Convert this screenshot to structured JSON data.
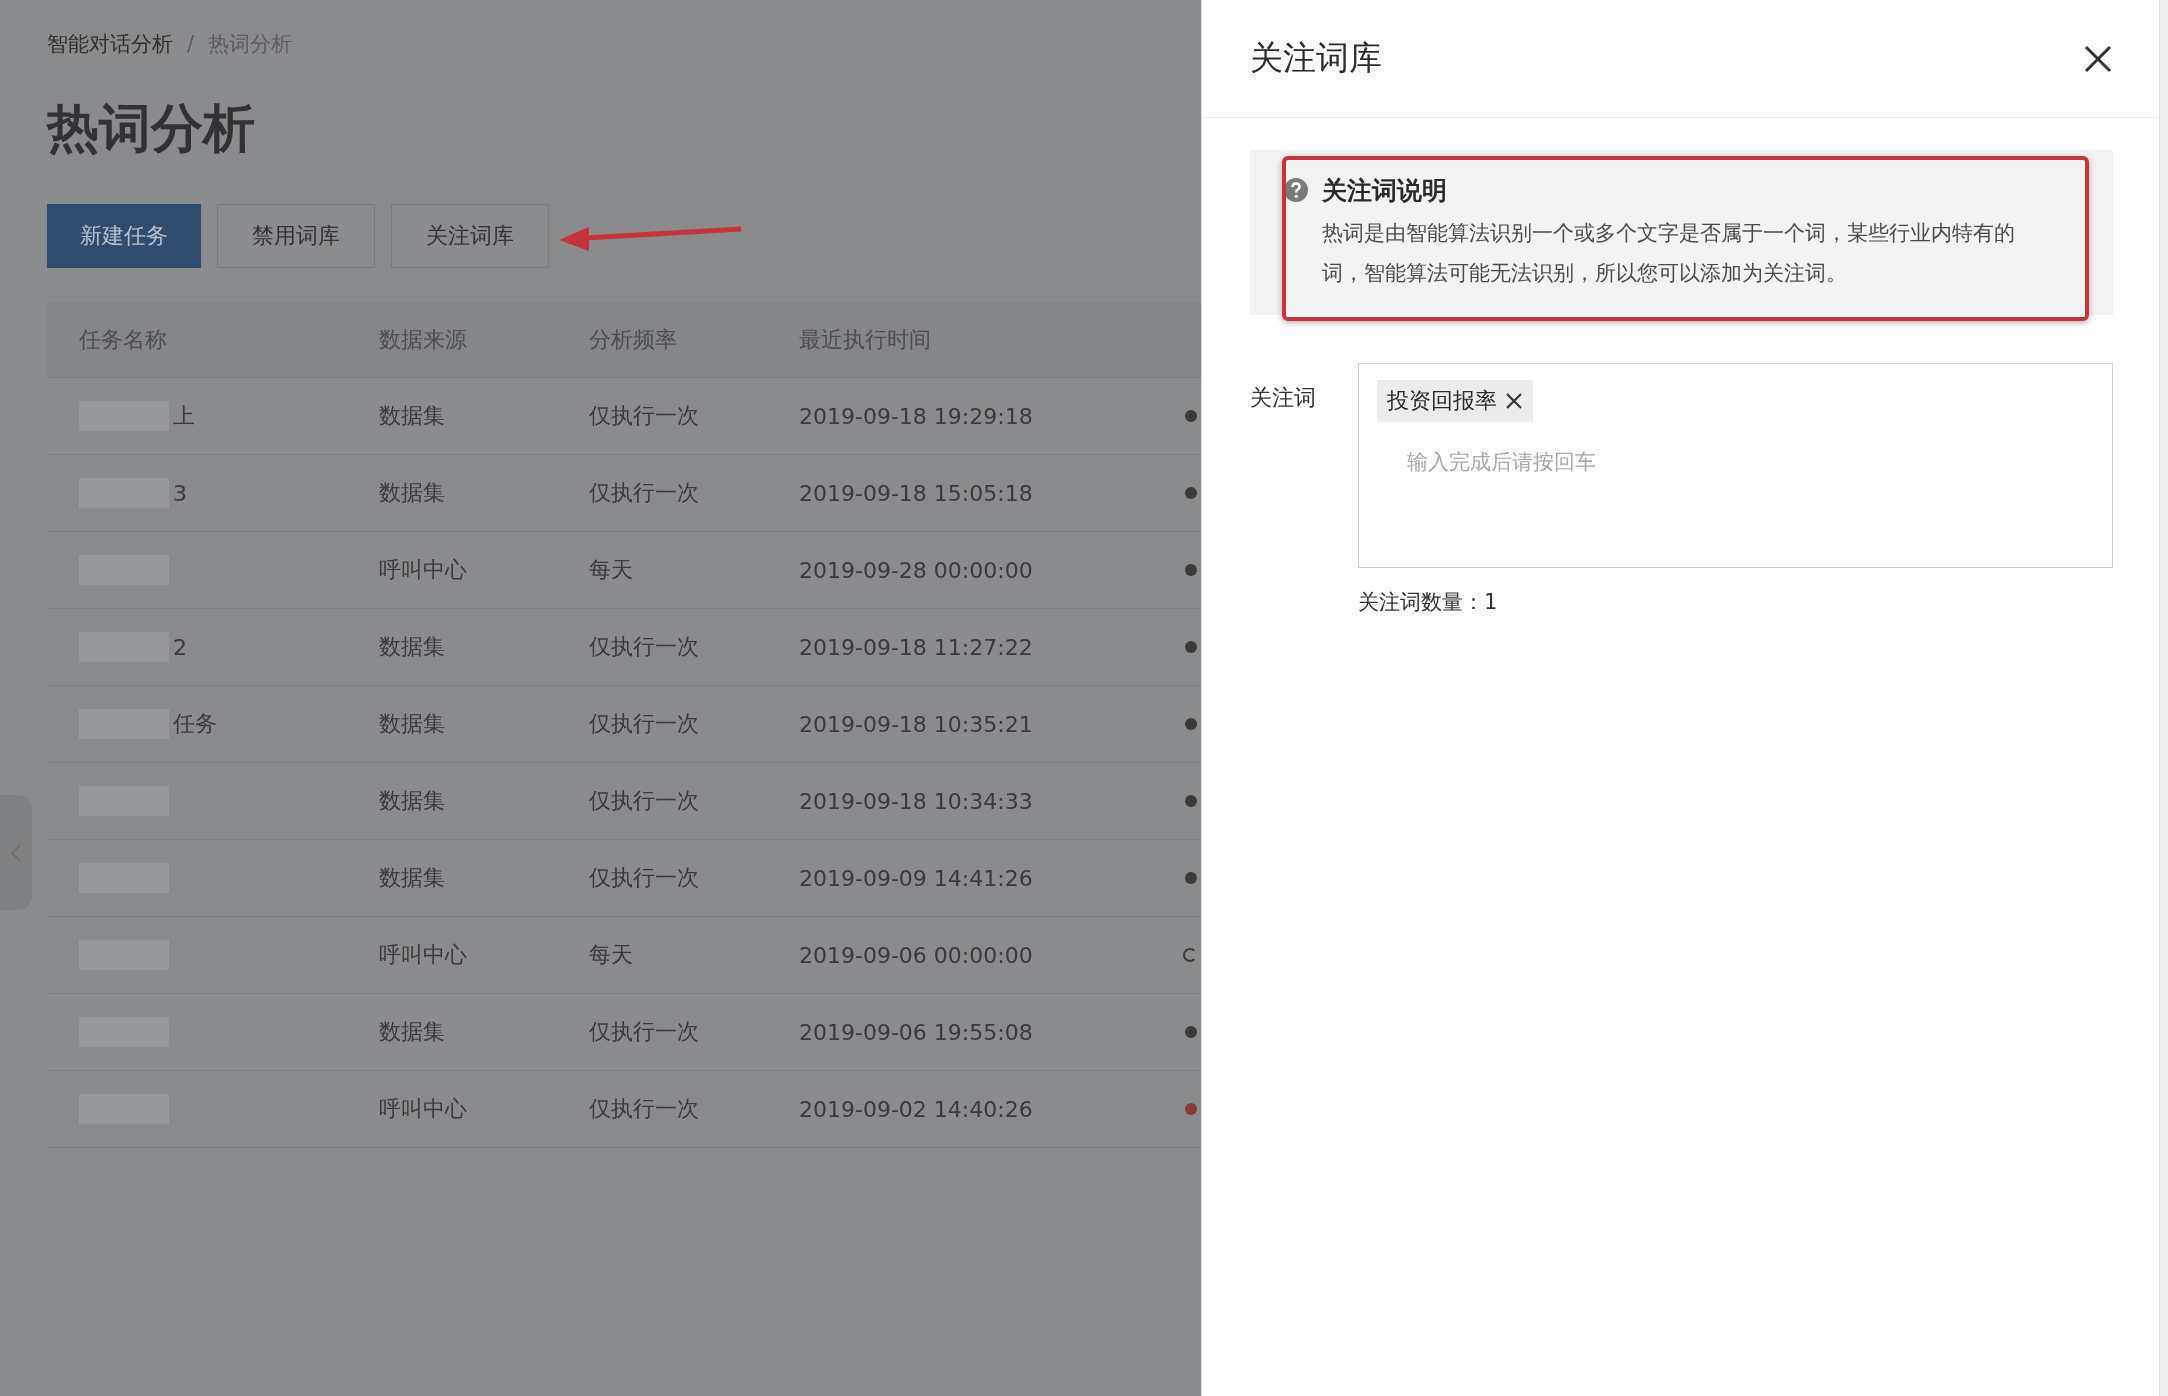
{
  "breadcrumb": [
    {
      "label": "智能对话分析",
      "current": false
    },
    {
      "label": "/",
      "kind": "separator"
    },
    {
      "label": "热词分析",
      "current": true
    }
  ],
  "page_title": "热词分析",
  "buttons": [
    {
      "label": "新建任务",
      "primary": true
    },
    {
      "label": "禁用词库",
      "primary": false
    },
    {
      "label": "关注词库",
      "primary": false,
      "annotated": true
    }
  ],
  "table": {
    "columns": [
      "任务名称",
      "数据来源",
      "分析频率",
      "最近执行时间"
    ],
    "rows": [
      {
        "name": "上",
        "redacted": true,
        "source": "数据集",
        "frequency": "仅执行一次",
        "time": "2019-09-18 19:29:18",
        "kind": "dot",
        "color": "#3a3a3a"
      },
      {
        "name": "3",
        "redacted": true,
        "source": "数据集",
        "frequency": "仅执行一次",
        "time": "2019-09-18 15:05:18",
        "kind": "dot",
        "color": "#3a3a3a"
      },
      {
        "redacted": true,
        "source": "呼叫中心",
        "frequency": "每天",
        "time": "2019-09-28 00:00:00",
        "kind": "dot",
        "color": "#3a3a3a"
      },
      {
        "name": "2",
        "redacted": true,
        "source": "数据集",
        "frequency": "仅执行一次",
        "time": "2019-09-18 11:27:22",
        "kind": "dot",
        "color": "#3a3a3a"
      },
      {
        "name": "任务",
        "redacted": true,
        "source": "数据集",
        "frequency": "仅执行一次",
        "time": "2019-09-18 10:35:21",
        "kind": "dot",
        "color": "#3a3a3a"
      },
      {
        "redacted": true,
        "source": "数据集",
        "frequency": "仅执行一次",
        "time": "2019-09-18 10:34:33",
        "kind": "dot",
        "color": "#3a3a3a"
      },
      {
        "redacted": true,
        "source": "数据集",
        "frequency": "仅执行一次",
        "time": "2019-09-09 14:41:26",
        "kind": "dot",
        "color": "#3a3a3a"
      },
      {
        "redacted": true,
        "source": "呼叫中心",
        "frequency": "每天",
        "time": "2019-09-06 00:00:00",
        "kind": "spinner",
        "color": "#3a3a3a"
      },
      {
        "redacted": true,
        "source": "数据集",
        "frequency": "仅执行一次",
        "time": "2019-09-06 19:55:08",
        "kind": "dot",
        "color": "#3a3a3a"
      },
      {
        "redacted": true,
        "source": "呼叫中心",
        "frequency": "仅执行一次",
        "time": "2019-09-02 14:40:26",
        "kind": "dot",
        "color": "#8a3a3e"
      }
    ]
  },
  "drawer": {
    "title": "关注词库",
    "notice": {
      "annotated": true,
      "title": "关注词说明",
      "text": "热词是由智能算法识别一个或多个文字是否属于一个词，某些行业内特有的词，智能算法可能无法识别，所以您可以添加为关注词。"
    },
    "field_label": "关注词",
    "tags": [
      {
        "label": "投资回报率"
      }
    ],
    "placeholder": "输入完成后请按回车",
    "count": "关注词数量：1"
  }
}
